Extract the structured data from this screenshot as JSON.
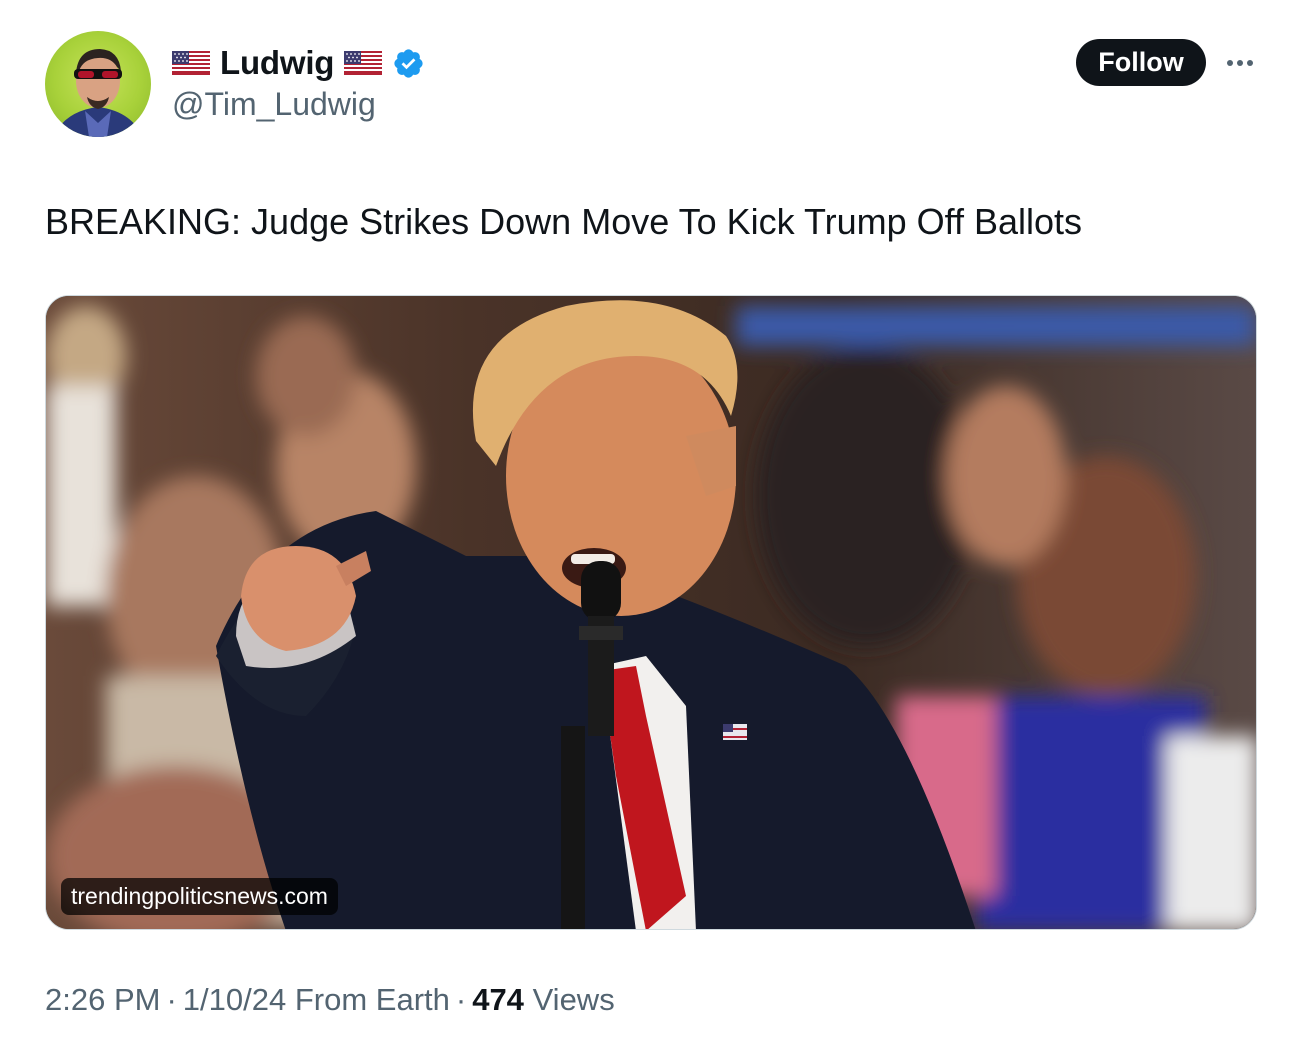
{
  "author": {
    "display_name": "Ludwig",
    "handle": "@Tim_Ludwig",
    "verified": true,
    "flag_icon": "us-flag-icon",
    "accent_color": "#1d9bf0"
  },
  "actions": {
    "follow_label": "Follow",
    "more_icon": "more-horizontal-icon"
  },
  "tweet": {
    "text": "BREAKING: Judge Strikes Down Move To Kick Trump Off Ballots"
  },
  "media": {
    "source_label": "trendingpoliticsnews.com"
  },
  "meta": {
    "time": "2:26 PM",
    "date": "1/10/24",
    "source": "From Earth",
    "views_count": "474",
    "views_label": "Views",
    "separator": "·"
  }
}
